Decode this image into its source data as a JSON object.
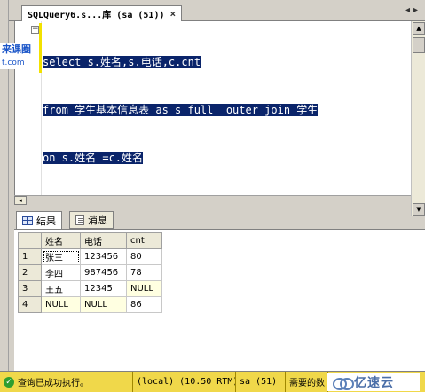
{
  "watermark": {
    "line1": "来课圈",
    "line2": "t.com"
  },
  "tab": {
    "title": "SQLQuery6.s...库 (sa (51))",
    "close": "×",
    "nav_left": "◂",
    "nav_right": "▸"
  },
  "editor": {
    "lines": [
      "select s.姓名,s.电话,c.cnt",
      "from 学生基本信息表 as s full  outer join 学生",
      "on s.姓名 =c.姓名"
    ]
  },
  "results_tabs": {
    "results": "结果",
    "messages": "消息"
  },
  "grid": {
    "columns": [
      "姓名",
      "电话",
      "cnt"
    ],
    "rows": [
      {
        "num": "1",
        "cells": [
          "张三",
          "123456",
          "80"
        ]
      },
      {
        "num": "2",
        "cells": [
          "李四",
          "987456",
          "78"
        ]
      },
      {
        "num": "3",
        "cells": [
          "王五",
          "12345",
          "NULL"
        ]
      },
      {
        "num": "4",
        "cells": [
          "NULL",
          "NULL",
          "86"
        ]
      }
    ]
  },
  "statusbar": {
    "status": "查询已成功执行。",
    "server": "(local) (10.50 RTM)",
    "user": "sa (51)",
    "db": "需要的数"
  },
  "logo": {
    "text": "亿速云"
  }
}
